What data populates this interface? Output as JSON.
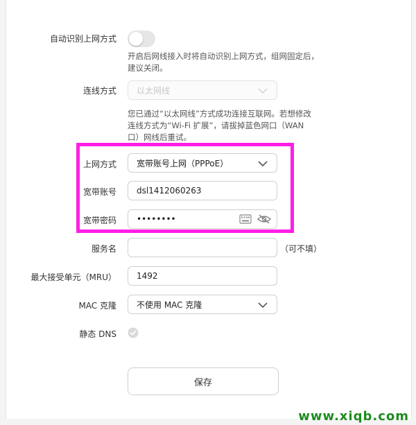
{
  "auto_detect": {
    "label": "自动识别上网方式",
    "hint_line1": "开启后网线接入时将自动识别上网方式，组网固定后，",
    "hint_line2": "建议关闭。"
  },
  "connection_type": {
    "label": "连线方式",
    "value": "以太网线",
    "hint_line1": "您已通过“以太网线”方式成功连接互联网。若想修改",
    "hint_line2": "连线方式为“Wi-Fi 扩展”，请拔掉蓝色网口（WAN",
    "hint_line3": "口）网线后重试。"
  },
  "internet_mode": {
    "label": "上网方式",
    "value": "宽带账号上网（PPPoE）"
  },
  "account": {
    "label": "宽带账号",
    "value": "dsl1412060263"
  },
  "password": {
    "label": "宽带密码",
    "value": "••••••••"
  },
  "service_name": {
    "label": "服务名",
    "value": "",
    "note": "（可不填）"
  },
  "mru": {
    "label": "最大接受单元（MRU）",
    "value": "1492"
  },
  "mac_clone": {
    "label": "MAC 克隆",
    "value": "不使用 MAC 克隆"
  },
  "static_dns": {
    "label": "静态 DNS"
  },
  "save_label": "保存",
  "watermark": "www.xiqb.com",
  "colors": {
    "highlight": "#ff1ee6",
    "watermark": "#1e8c1e"
  }
}
